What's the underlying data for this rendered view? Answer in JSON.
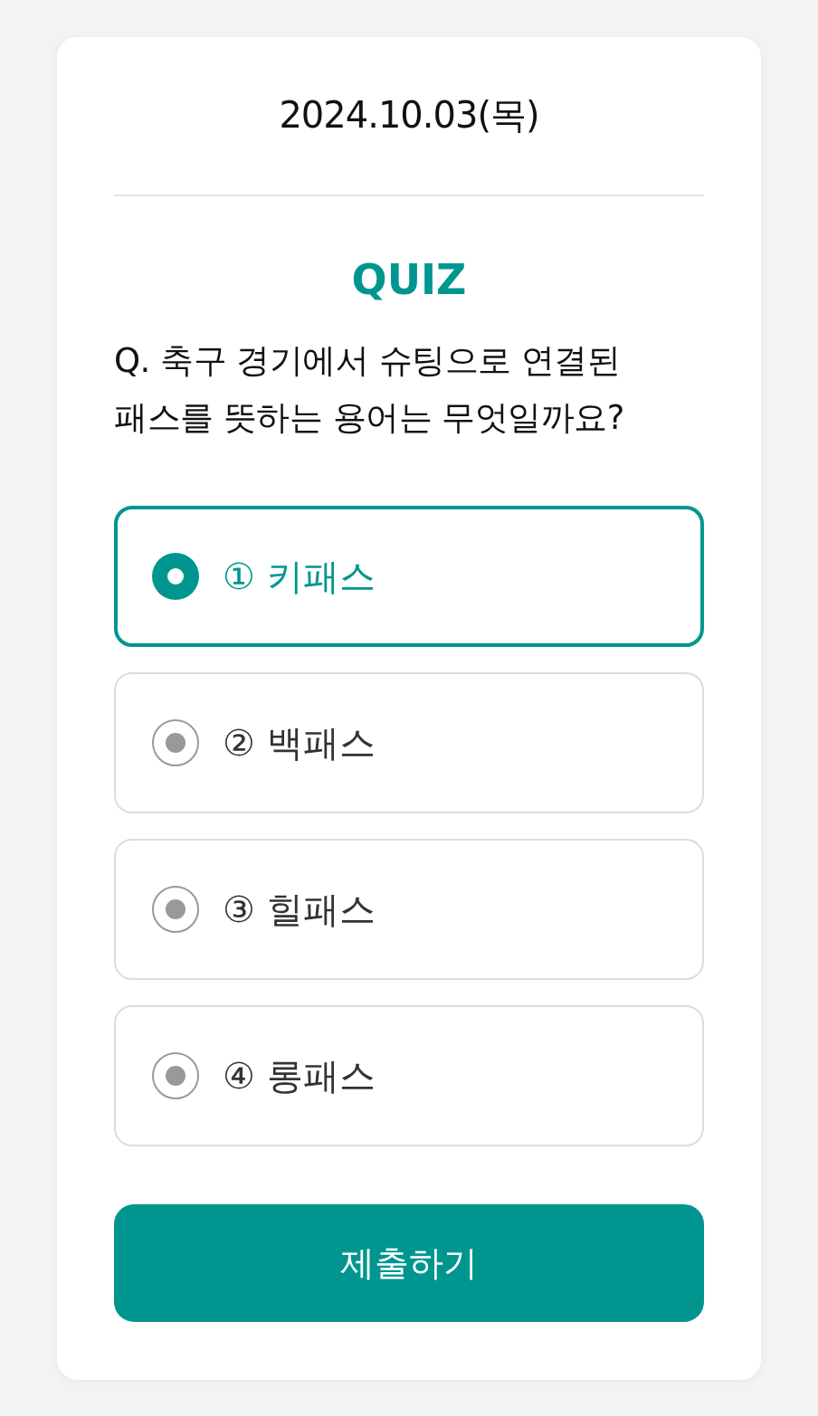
{
  "date": "2024.10.03(목)",
  "quiz": {
    "title": "QUIZ",
    "question": "Q. 축구 경기에서 슈팅으로 연결된 패스를 뜻하는 용어는 무엇일까요?"
  },
  "options": [
    {
      "label": "① 키패스",
      "selected": true
    },
    {
      "label": "② 백패스",
      "selected": false
    },
    {
      "label": "③ 힐패스",
      "selected": false
    },
    {
      "label": "④ 롱패스",
      "selected": false
    }
  ],
  "submit_button": {
    "label": "제출하기"
  }
}
